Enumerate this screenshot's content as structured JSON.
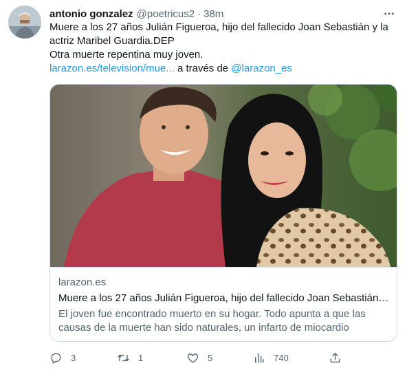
{
  "tweet": {
    "author_name": "antonio gonzalez",
    "author_handle": "@poetricus2",
    "separator": "·",
    "time": "38m",
    "text_line1": "Muere a los 27 años Julián Figueroa, hijo del fallecido Joan Sebastián y la actriz Maribel Guardia.DEP",
    "text_line2": "Otra muerte repentina muy joven.",
    "link_text": "larazon.es/television/mue...",
    "via_text": "a través de",
    "via_handle": "@larazon_es"
  },
  "card": {
    "domain": "larazon.es",
    "title": "Muere a los 27 años Julián Figueroa, hijo del fallecido Joan Sebastián y...",
    "description": "El joven fue encontrado muerto en su hogar. Todo apunta a que las causas de la muerte han sido naturales, un infarto de miocardio"
  },
  "actions": {
    "replies": "3",
    "retweets": "1",
    "likes": "5",
    "views": "740"
  },
  "colors": {
    "link": "#1d9bf0",
    "secondary_text": "#536471",
    "border": "#cfd9de"
  },
  "icons": [
    "more-icon",
    "reply-icon",
    "retweet-icon",
    "like-icon",
    "views-icon",
    "share-icon"
  ]
}
